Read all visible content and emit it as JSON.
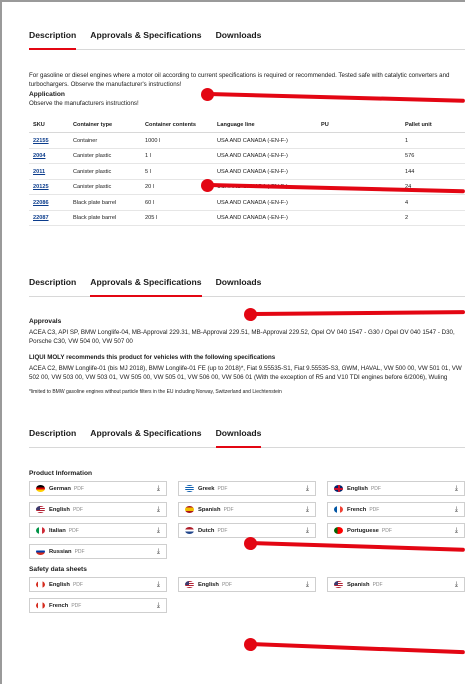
{
  "tabs": [
    "Description",
    "Approvals & Specifications",
    "Downloads"
  ],
  "description": {
    "text": "For gasoline or diesel engines where a motor oil according to current specifications is required or recommended. Tested safe with catalytic converters and turbochargers. Observe the manufacturer's instructions!",
    "application_title": "Application",
    "application_text": "Observe the manufacturers instructions!"
  },
  "table": {
    "headers": [
      "SKU",
      "Container type",
      "Container contents",
      "Language line",
      "PU",
      "Pallet unit"
    ],
    "rows": [
      [
        "22155",
        "Container",
        "1000 l",
        "USA AND CANADA (-EN-F-)",
        "",
        "1"
      ],
      [
        "2004",
        "Canister plastic",
        "1 l",
        "USA AND CANADA (-EN-F-)",
        "",
        "576"
      ],
      [
        "2011",
        "Canister plastic",
        "5 l",
        "USA AND CANADA (-EN-F-)",
        "",
        "144"
      ],
      [
        "20125",
        "Canister plastic",
        "20 l",
        "USA AND CANADA (-EN-F-)",
        "",
        "24"
      ],
      [
        "22086",
        "Black plate barrel",
        "60 l",
        "USA AND CANADA (-EN-F-)",
        "",
        "4"
      ],
      [
        "22087",
        "Black plate barrel",
        "205 l",
        "USA AND CANADA (-EN-F-)",
        "",
        "2"
      ]
    ]
  },
  "approvals": {
    "title": "Approvals",
    "text": "ACEA C3, API SP, BMW Longlife-04, MB-Approval 229.31, MB-Approval 229.51, MB-Approval 229.52, Opel OV 040 1547 - G30 / Opel OV 040 1547 - D30, Porsche C30, VW 504 00, VW 507 00",
    "recommend_title": "LIQUI MOLY recommends this product for vehicles with the following specifications",
    "recommend_text": "ACEA C2, BMW Longlife-01 (bis MJ 2018), BMW Longlife-01 FE (up to 2018)*, Fiat 9.55535-S1, Fiat 9.55535-S3, GWM, HAVAL, VW 500 00, VW 501 01, VW 502 00, VW 503 00, VW 503 01, VW 505 00, VW 505 01, VW 506 00, VW 506 01 (With the exception of R5 and V10 TDI engines before 6/2006), Wuling",
    "footnote": "*limited to BMW gasoline engines without particle filters in the EU including Norway, Switzerland and Liechtenstein"
  },
  "downloads": {
    "product_info_title": "Product Information",
    "product_info": [
      {
        "label": "German",
        "type": "PDF",
        "flag": "de"
      },
      {
        "label": "Greek",
        "type": "PDF",
        "flag": "gr"
      },
      {
        "label": "English",
        "type": "PDF",
        "flag": "uk"
      },
      {
        "label": "English",
        "type": "PDF",
        "flag": "us"
      },
      {
        "label": "Spanish",
        "type": "PDF",
        "flag": "es"
      },
      {
        "label": "French",
        "type": "PDF",
        "flag": "fr"
      },
      {
        "label": "Italian",
        "type": "PDF",
        "flag": "it"
      },
      {
        "label": "Dutch",
        "type": "PDF",
        "flag": "nl"
      },
      {
        "label": "Portuguese",
        "type": "PDF",
        "flag": "pt"
      },
      {
        "label": "Russian",
        "type": "PDF",
        "flag": "ru"
      }
    ],
    "safety_title": "Safety data sheets",
    "safety": [
      {
        "label": "English",
        "type": "PDF",
        "flag": "ca"
      },
      {
        "label": "English",
        "type": "PDF",
        "flag": "us"
      },
      {
        "label": "Spanish",
        "type": "PDF",
        "flag": "us"
      },
      {
        "label": "French",
        "type": "PDF",
        "flag": "ca"
      }
    ],
    "download_icon": "download-icon"
  },
  "colors": {
    "accent": "#e30613",
    "link": "#0b3c8c"
  }
}
